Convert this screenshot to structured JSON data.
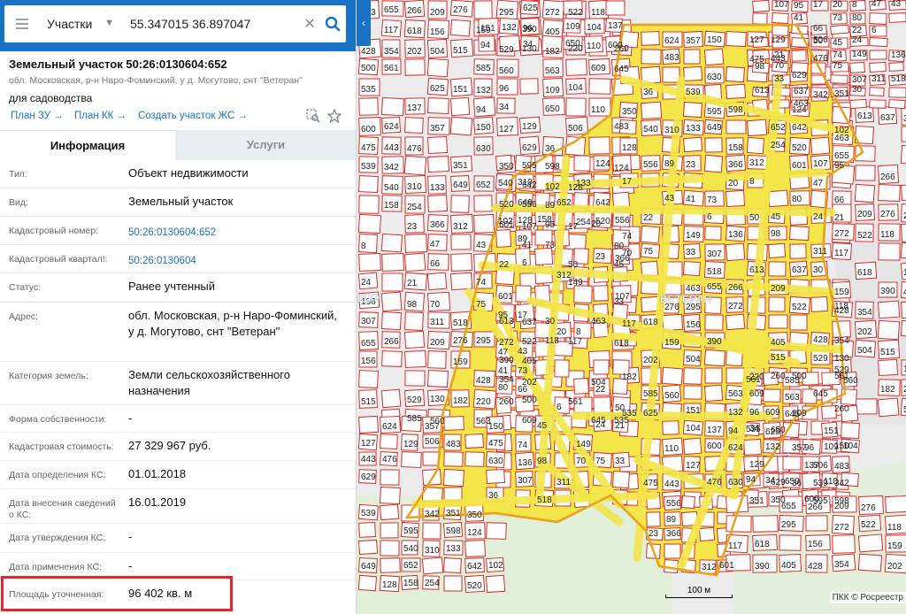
{
  "search": {
    "type_label": "Участки",
    "coords_value": "55.347015 36.897047",
    "clear_glyph": "✕",
    "collapse_glyph": "‹"
  },
  "object": {
    "title": "Земельный участок 50:26:0130604:652",
    "address": "обл. Московская, р-н Наро-Фоминский, у д. Могутово, снт \"Ветеран\"",
    "purpose": "для садоводства"
  },
  "links": {
    "plan_zu": "План ЗУ →",
    "plan_kk": "План КК →",
    "create_js": "Создать участок ЖС →"
  },
  "tabs": {
    "info": "Информация",
    "services": "Услуги"
  },
  "rows": [
    {
      "key": "Тип:",
      "value": "Объект недвижимости"
    },
    {
      "key": "Вид:",
      "value": "Земельный участок"
    },
    {
      "key": "Кадастровый номер:",
      "value": "50:26:0130604:652"
    },
    {
      "key": "Кадастровый квартал!:",
      "value": "50:26:0130604"
    },
    {
      "key": "Статус:",
      "value": "Ранее учтенный"
    },
    {
      "key": "Адрес:",
      "value": "обл. Московская, р-н Наро-Фоминский, у д. Могутово, снт \"Ветеран\""
    },
    {
      "key": "Категория земель:",
      "value": "Земли сельскохозяйственного назначения"
    },
    {
      "key": "Форма собственности:",
      "value": "-"
    },
    {
      "key": "Кадастровая стоимость:",
      "value": "27 329 967 руб."
    },
    {
      "key": "Дата определения КС:",
      "value": "01.01.2018"
    },
    {
      "key": "Дата внесения сведений о КС:",
      "value": "16.01.2019"
    },
    {
      "key": "Дата утверждения КС:",
      "value": "-"
    },
    {
      "key": "Дата применения КС:",
      "value": "-"
    },
    {
      "key": "Площадь уточненная:",
      "value": "96 402 кв. м"
    }
  ],
  "map": {
    "place_labels": [
      "ВЕТЕРАН",
      "ЩКИ"
    ],
    "scale_label": "100 м",
    "attribution": "ПКК © Росреестр",
    "colors": {
      "plot_border": "#d3312f",
      "highlight": "#f2e64a",
      "highlight_border": "#e8a21c"
    },
    "plot_numbers": [
      "463",
      "655",
      "266",
      "209",
      "276",
      "295",
      "272",
      "522",
      "118",
      "117",
      "618",
      "156",
      "159",
      "390",
      "405",
      "428",
      "354",
      "202",
      "504",
      "515",
      "529",
      "130",
      "182",
      "220",
      "260",
      "500",
      "561",
      "585",
      "560",
      "563",
      "609",
      "645",
      "535",
      "625",
      "151",
      "132",
      "96",
      "109",
      "104",
      "137",
      "94",
      "34",
      "650",
      "110",
      "600",
      "624",
      "357",
      "150",
      "127",
      "129",
      "506",
      "483",
      "475",
      "443",
      "476",
      "630",
      "629",
      "36",
      "539",
      "342",
      "351",
      "350",
      "595",
      "598",
      "124",
      "540",
      "310",
      "133",
      "649",
      "652",
      "642",
      "102",
      "128",
      "158",
      "254",
      "520",
      "556",
      "89",
      "23",
      "366",
      "312",
      "601",
      "107",
      "95",
      "17",
      "20",
      "8",
      "47",
      "43",
      "41",
      "73",
      "80",
      "66",
      "22",
      "6",
      "50",
      "45",
      "24",
      "21",
      "74",
      "149",
      "136",
      "98",
      "70",
      "75",
      "33",
      "307",
      "311",
      "518",
      "613",
      "637",
      "30"
    ]
  }
}
